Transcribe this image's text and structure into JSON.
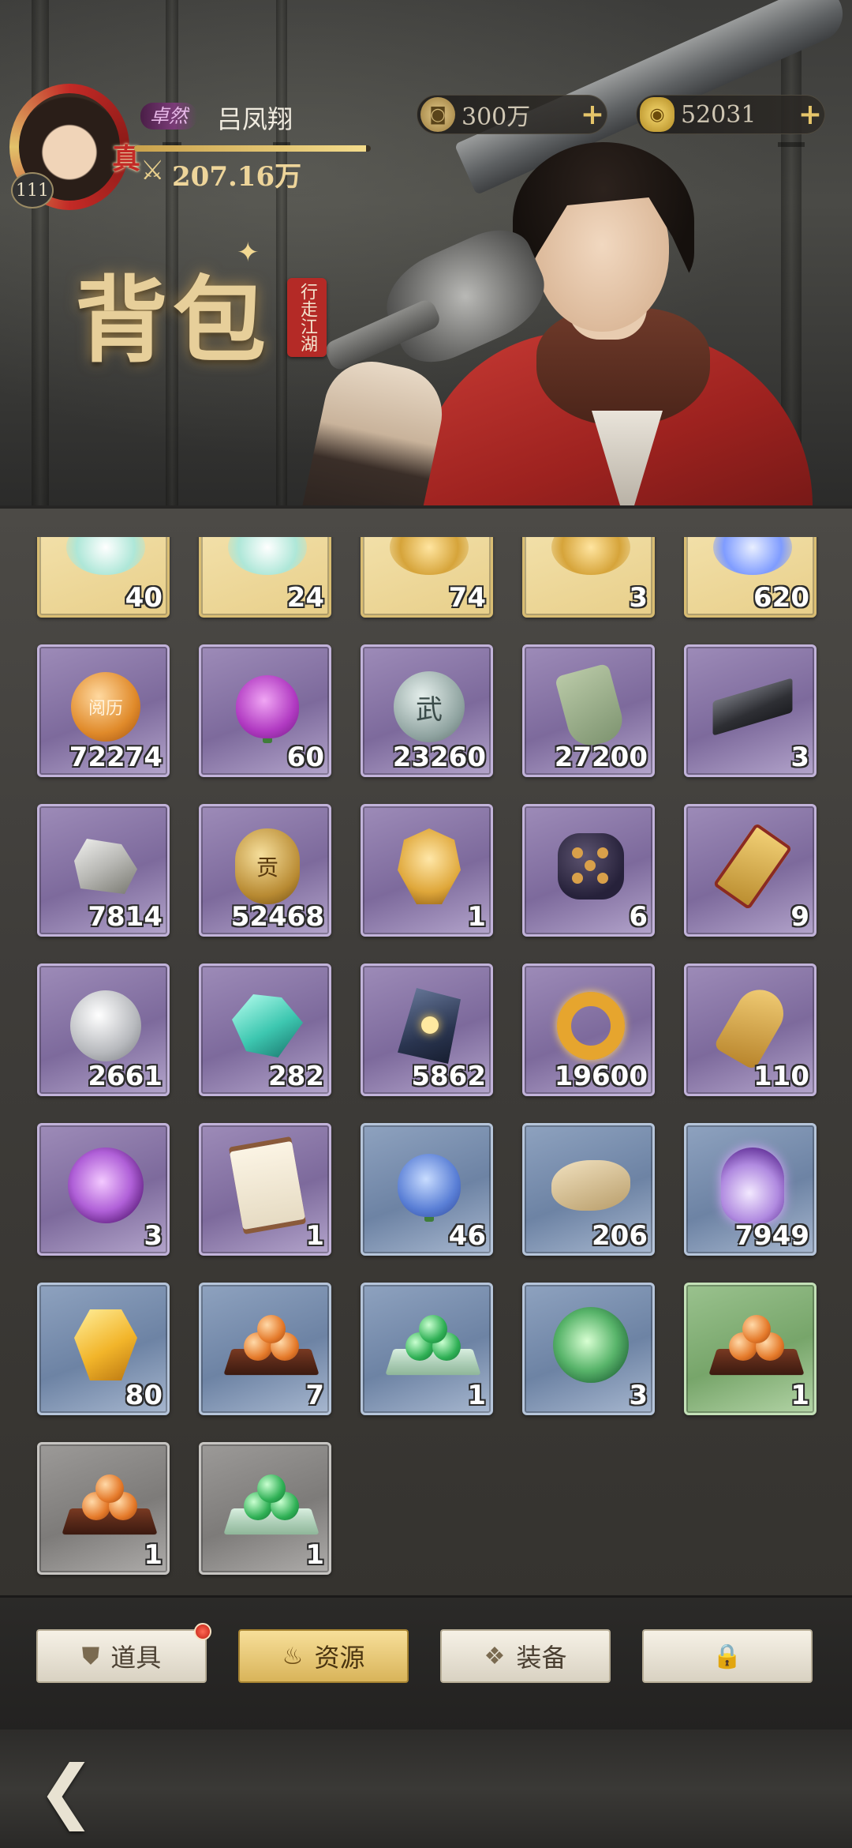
{
  "player": {
    "level": "111",
    "zhen_badge": "真",
    "rank": "卓然",
    "name": "吕凤翔",
    "power_icon": "⚔",
    "power": "207.16万",
    "power_progress": 0.98
  },
  "currencies": [
    {
      "icon": "copper-coin-icon",
      "glyph": "◙",
      "value": "300万",
      "plus": "+"
    },
    {
      "icon": "gold-ingot-icon",
      "glyph": "◉",
      "value": "52031",
      "plus": "+"
    }
  ],
  "banner": {
    "title": "背包",
    "seal": "行走江湖"
  },
  "items": [
    {
      "rarity": "gold",
      "icon": "partial-item-icon",
      "art": "partial",
      "count": "40"
    },
    {
      "rarity": "gold",
      "icon": "partial-item-icon",
      "art": "partial",
      "count": "24"
    },
    {
      "rarity": "gold",
      "icon": "partial-item-icon",
      "art": "partial gold",
      "count": "74"
    },
    {
      "rarity": "gold",
      "icon": "partial-item-icon",
      "art": "partial gold",
      "count": "3"
    },
    {
      "rarity": "gold",
      "icon": "partial-item-icon",
      "art": "partial blue",
      "count": "620"
    },
    {
      "rarity": "purple",
      "icon": "experience-orb-icon",
      "art": "orb",
      "label": "阅历",
      "count": "72274"
    },
    {
      "rarity": "purple",
      "icon": "purple-rose-icon",
      "art": "rose",
      "count": "60"
    },
    {
      "rarity": "purple",
      "icon": "martial-coin-icon",
      "art": "coin",
      "label": "武",
      "count": "23260"
    },
    {
      "rarity": "purple",
      "icon": "jade-tablet-icon",
      "art": "tablet",
      "count": "27200"
    },
    {
      "rarity": "purple",
      "icon": "iron-ingot-icon",
      "art": "ingot",
      "count": "3"
    },
    {
      "rarity": "purple",
      "icon": "ore-icon",
      "art": "rock",
      "count": "7814"
    },
    {
      "rarity": "purple",
      "icon": "bronze-medal-icon",
      "art": "medal",
      "label": "贡",
      "count": "52468"
    },
    {
      "rarity": "purple",
      "icon": "golden-mask-icon",
      "art": "mask",
      "count": "1"
    },
    {
      "rarity": "purple",
      "icon": "dice-icon",
      "art": "dice",
      "count": "6"
    },
    {
      "rarity": "purple",
      "icon": "golden-token-icon",
      "art": "token",
      "count": "9"
    },
    {
      "rarity": "purple",
      "icon": "silver-coin-icon",
      "art": "coin silver",
      "label": "",
      "count": "2661"
    },
    {
      "rarity": "purple",
      "icon": "jade-crystal-icon",
      "art": "crystal",
      "count": "282"
    },
    {
      "rarity": "purple",
      "icon": "spirit-stone-icon",
      "art": "stone",
      "count": "5862"
    },
    {
      "rarity": "purple",
      "icon": "golden-ring-icon",
      "art": "ring",
      "count": "19600"
    },
    {
      "rarity": "purple",
      "icon": "golden-charm-icon",
      "art": "charm",
      "count": "110"
    },
    {
      "rarity": "purple",
      "icon": "purple-disc-icon",
      "art": "disc",
      "count": "3"
    },
    {
      "rarity": "purple",
      "icon": "scroll-icon",
      "art": "scroll",
      "count": "1"
    },
    {
      "rarity": "blue",
      "icon": "blue-rose-icon",
      "art": "rose blue",
      "count": "46"
    },
    {
      "rarity": "blue",
      "icon": "fish-scroll-icon",
      "art": "fish",
      "count": "206"
    },
    {
      "rarity": "blue",
      "icon": "potion-icon",
      "art": "potion",
      "count": "7949"
    },
    {
      "rarity": "blue",
      "icon": "gold-gem-icon",
      "art": "gem",
      "count": "80"
    },
    {
      "rarity": "blue",
      "icon": "orange-dumpling-tray-icon",
      "art": "tray orange",
      "count": "7"
    },
    {
      "rarity": "blue",
      "icon": "green-dumpling-tray-icon",
      "art": "tray green",
      "count": "1"
    },
    {
      "rarity": "blue",
      "icon": "green-disc-icon",
      "art": "disc green",
      "count": "3"
    },
    {
      "rarity": "green",
      "icon": "orange-dumpling-tray-icon",
      "art": "tray orange",
      "count": "1"
    },
    {
      "rarity": "gray",
      "icon": "orange-dumpling-tray-icon",
      "art": "tray orange",
      "count": "1"
    },
    {
      "rarity": "gray",
      "icon": "green-dumpling-tray-icon",
      "art": "tray green",
      "count": "1"
    }
  ],
  "tabs": [
    {
      "label": "道具",
      "icon": "props-icon",
      "glyph": "⛊",
      "active": false,
      "dot": true
    },
    {
      "label": "资源",
      "icon": "resource-bag-icon",
      "glyph": "♨",
      "active": true,
      "dot": false
    },
    {
      "label": "装备",
      "icon": "equipment-icon",
      "glyph": "❖",
      "active": false,
      "dot": false
    },
    {
      "label": "",
      "icon": "lock-icon",
      "glyph": "🔒",
      "active": false,
      "dot": false
    }
  ],
  "footer": {
    "back_glyph": "❮"
  }
}
